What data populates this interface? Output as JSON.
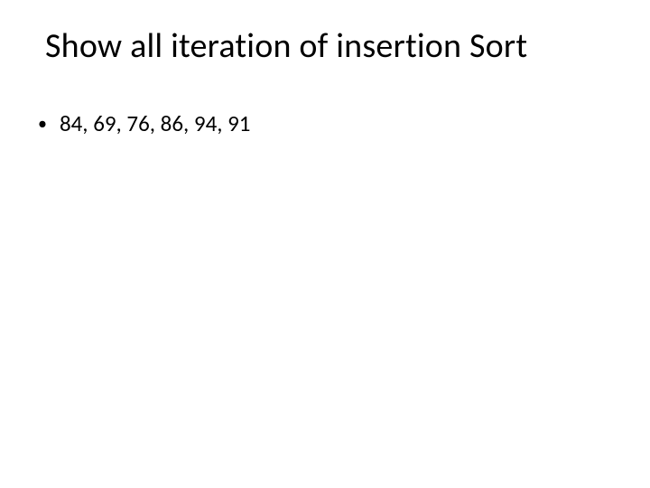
{
  "title": "Show all iteration of insertion Sort",
  "bullets": [
    {
      "marker": "•",
      "text": "84, 69, 76, 86, 94, 91"
    }
  ]
}
